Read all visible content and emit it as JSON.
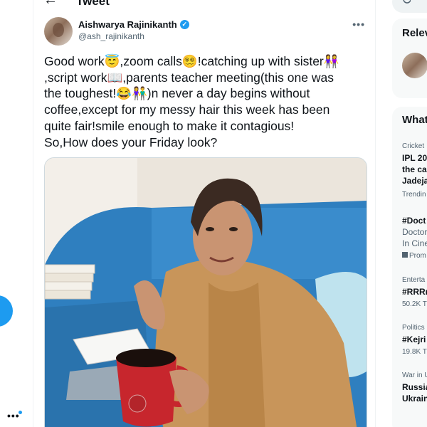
{
  "header": {
    "title": "Tweet"
  },
  "tweet": {
    "author_name": "Aishwarya Rajinikanth",
    "handle": "@ash_rajinikanth",
    "lines": [
      "Good work😇,zoom calls😵‍💫!catching up with sister👭",
      ",script work📖,parents teacher meeting(this one was",
      "the toughest!😂👫)n never a day begins without",
      "coffee,except for my messy hair this week has been",
      "quite fair!smile enough to make it contagious!",
      "So,How does your Friday look?"
    ]
  },
  "right_sidebar": {
    "relevant_title": "Relev",
    "whats_title": "What",
    "trends": [
      {
        "category": "Cricket",
        "lines": [
          "IPL 20",
          "the ca",
          "Jadeja"
        ],
        "meta": "Trendin"
      },
      {
        "category": "",
        "lines": [
          "#Doct"
        ],
        "desc": [
          "Doctor",
          "In Cine"
        ],
        "meta": "Prom"
      },
      {
        "category": "Enterta",
        "lines": [
          "#RRRn"
        ],
        "meta": "50.2K T"
      },
      {
        "category": "Politics",
        "lines": [
          "#Kejri"
        ],
        "meta": "19.8K T"
      },
      {
        "category": "War in U",
        "lines": [
          "Russia",
          "Ukrain"
        ],
        "meta": ""
      }
    ]
  },
  "icons": {
    "back": "arrow-left-icon",
    "verified": "verified-badge-icon",
    "more": "more-horizontal-icon",
    "search": "search-icon",
    "promoted": "promoted-icon"
  },
  "colors": {
    "accent": "#1d9bf0",
    "secondary_text": "#536471",
    "primary_text": "#0f1419"
  }
}
